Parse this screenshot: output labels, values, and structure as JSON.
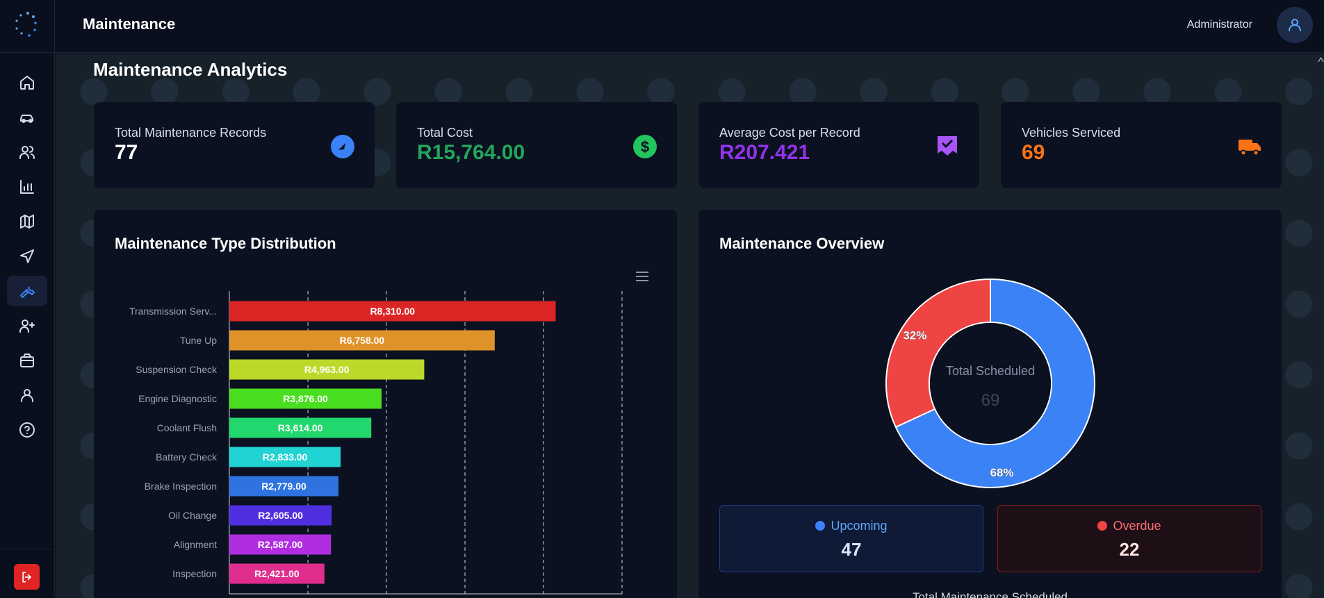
{
  "header": {
    "title": "Maintenance",
    "user": "Administrator"
  },
  "sidebar": {
    "items": [
      {
        "icon": "home-icon",
        "active": false
      },
      {
        "icon": "car-icon",
        "active": false
      },
      {
        "icon": "users-icon",
        "active": false
      },
      {
        "icon": "bar-chart-icon",
        "active": false
      },
      {
        "icon": "map-icon",
        "active": false
      },
      {
        "icon": "navigation-icon",
        "active": false
      },
      {
        "icon": "wrench-icon",
        "active": true
      },
      {
        "icon": "user-plus-icon",
        "active": false
      },
      {
        "icon": "package-icon",
        "active": false
      },
      {
        "icon": "user-icon",
        "active": false
      },
      {
        "icon": "help-circle-icon",
        "active": false
      }
    ],
    "logout_icon": "logout-icon"
  },
  "page": {
    "title": "Maintenance Analytics"
  },
  "stats": [
    {
      "label": "Total Maintenance Records",
      "value": "77",
      "color": "#ffffff",
      "icon": "gauge-icon",
      "icon_color": "#3b82f6"
    },
    {
      "label": "Total Cost",
      "value": "R15,764.00",
      "color": "#22a55b",
      "icon": "dollar-icon",
      "icon_color": "#22c55e"
    },
    {
      "label": "Average Cost per Record",
      "value": "R207.421",
      "color": "#9333ea",
      "icon": "receipt-check-icon",
      "icon_color": "#a855f7"
    },
    {
      "label": "Vehicles Serviced",
      "value": "69",
      "color": "#f97316",
      "icon": "truck-icon",
      "icon_color": "#f97316"
    }
  ],
  "distribution": {
    "title": "Maintenance Type Distribution",
    "menu_icon": "hamburger-menu-icon"
  },
  "chart_data": [
    {
      "type": "bar",
      "orientation": "horizontal",
      "title": "Maintenance Type Distribution",
      "categories": [
        "Transmission Serv...",
        "Tune Up",
        "Suspension Check",
        "Engine Diagnostic",
        "Coolant Flush",
        "Battery Check",
        "Brake Inspection",
        "Oil Change",
        "Alignment",
        "Inspection"
      ],
      "values": [
        8310,
        6758,
        4963,
        3876,
        3614,
        2833,
        2779,
        2605,
        2587,
        2421
      ],
      "value_labels": [
        "R8,310.00",
        "R6,758.00",
        "R4,963.00",
        "R3,876.00",
        "R3,614.00",
        "R2,833.00",
        "R2,779.00",
        "R2,605.00",
        "R2,587.00",
        "R2,421.00"
      ],
      "colors": [
        "#dc2626",
        "#e0922a",
        "#bcd92a",
        "#4ade20",
        "#22d86e",
        "#22d3d3",
        "#2e73e0",
        "#4f2fe0",
        "#b02ee0",
        "#e02e8e"
      ],
      "xlim": [
        0,
        10000
      ],
      "x_ticks": [
        "R0.00",
        "R2,000.00",
        "R4,000.00",
        "R6,000.00",
        "R8,000.00",
        "R10,000.00"
      ],
      "grid": true
    },
    {
      "type": "pie",
      "variant": "donut",
      "title": "Maintenance Overview",
      "center_label": "Total Scheduled",
      "center_value": "69",
      "series": [
        {
          "name": "Upcoming",
          "value": 47,
          "percent_label": "68%",
          "color": "#3b82f6"
        },
        {
          "name": "Overdue",
          "value": 22,
          "percent_label": "32%",
          "color": "#ef4444"
        }
      ]
    }
  ],
  "overview": {
    "title": "Maintenance Overview",
    "upcoming": {
      "label": "Upcoming",
      "value": "47"
    },
    "overdue": {
      "label": "Overdue",
      "value": "22"
    },
    "caption": "Total Maintenance Scheduled"
  }
}
